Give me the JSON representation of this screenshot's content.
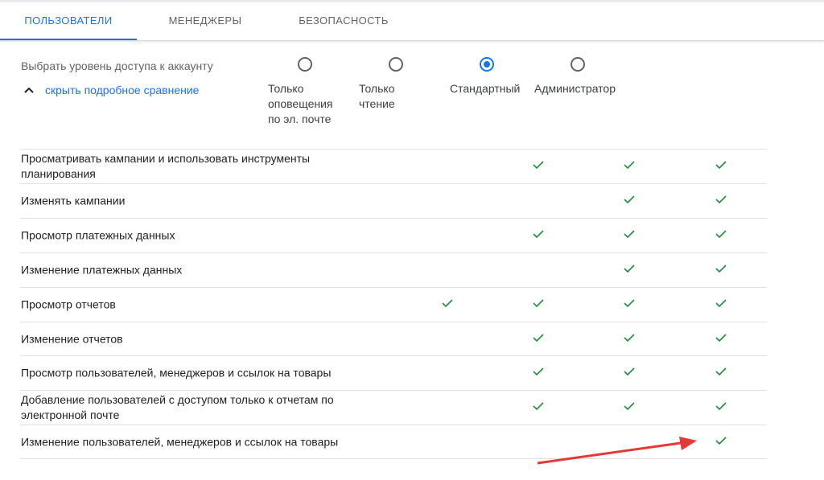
{
  "tabs": [
    {
      "label": "ПОЛЬЗОВАТЕЛИ",
      "active": true
    },
    {
      "label": "МЕНЕДЖЕРЫ",
      "active": false
    },
    {
      "label": "БЕЗОПАСНОСТЬ",
      "active": false
    }
  ],
  "access": {
    "label": "Выбрать уровень доступа к аккаунту",
    "toggle_label": "скрыть подробное сравнение",
    "selected": "standard",
    "options": [
      {
        "id": "email",
        "label": "Только\nоповещения\nпо эл. почте"
      },
      {
        "id": "read",
        "label": "Только\nчтение"
      },
      {
        "id": "standard",
        "label": "Стандартный"
      },
      {
        "id": "admin",
        "label": "Администратор"
      }
    ]
  },
  "comparison": {
    "rows": [
      {
        "label": "Просматривать кампании и использовать инструменты планирования",
        "checks": [
          false,
          true,
          true,
          true
        ]
      },
      {
        "label": "Изменять кампании",
        "checks": [
          false,
          false,
          true,
          true
        ]
      },
      {
        "label": "Просмотр платежных данных",
        "checks": [
          false,
          true,
          true,
          true
        ]
      },
      {
        "label": "Изменение платежных данных",
        "checks": [
          false,
          false,
          true,
          true
        ]
      },
      {
        "label": "Просмотр отчетов",
        "checks": [
          true,
          true,
          true,
          true
        ]
      },
      {
        "label": "Изменение отчетов",
        "checks": [
          false,
          true,
          true,
          true
        ]
      },
      {
        "label": "Просмотр пользователей, менеджеров и ссылок на товары",
        "checks": [
          false,
          true,
          true,
          true
        ]
      },
      {
        "label": "Добавление пользователей с доступом только к отчетам по электронной почте",
        "checks": [
          false,
          true,
          true,
          true
        ]
      },
      {
        "label": "Изменение пользователей, менеджеров и ссылок на товары",
        "checks": [
          false,
          false,
          false,
          true
        ]
      }
    ]
  },
  "colors": {
    "accent": "#1a73e8",
    "check": "#1e8e3e",
    "annotation_arrow": "#e53935"
  },
  "icons": {
    "toggle": "chevron-up-icon",
    "check": "check-icon",
    "annotation": "red-arrow-annotation"
  }
}
